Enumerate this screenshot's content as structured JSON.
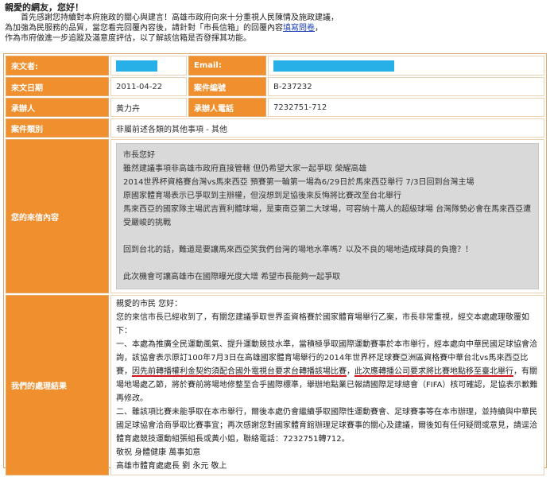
{
  "intro": {
    "greeting": "親愛的網友，您好！",
    "line1": "首先感謝您持續對本府施政的關心與建言！高雄市政府向來十分重視人民陳情及施政建議，",
    "line2_before": "為加強為民服務的品質，當您看完回覆內容後，請針對「市長信箱」的回覆內容",
    "line2_link": "填寫問卷",
    "line2_after": "，",
    "line3": "作為市府做進一步追蹤及滿意度評估，以了解該信箱是否發揮其功能。"
  },
  "fields": {
    "sender_label": "來文者:",
    "email_label": "Email:",
    "date_label": "來文日期",
    "date_value": "2011-04-22",
    "case_no_label": "案件編號",
    "case_no_value": "B-237232",
    "handler_label": "承辦人",
    "handler_value": "黃力卉",
    "handler_phone_label": "承辦人電話",
    "handler_phone_value": "7232751-712",
    "category_label": "案件類別",
    "category_value": "非屬前述各類的其他事項 - 其他",
    "letter_label": "您的來信內容",
    "result_label": "我們的處理結果"
  },
  "letter": {
    "l1": "市長您好",
    "l2": "雖然建議事項非高雄市政府直接管轄 但仍希望大家一起爭取 榮耀高雄",
    "l3": "2014世界杯資格賽台灣vs馬來西亞 預賽第一輪第一場為6/29日於馬來西亞舉行 7/3日回到台灣主場",
    "l4": "原國家體育場表示已爭取到主辦權，但沒想到足協後來反悔將比賽改至台北舉行",
    "l5": "馬來西亞的國家隊主場武吉賈利體球場，是東南亞第二大球場，可容納十萬人的超級球場 台灣隊勢必會在馬來西亞遭受嚴峻的挑戰",
    "l6": "回到台北的話，難道是要讓馬來西亞笑我們台灣的場地水準嗎？以及不良的場地造成球員的負擔？！",
    "l7": "此次機會可讓高雄市在國際曝光度大增 希望市長能夠一起爭取"
  },
  "reply": {
    "r1": "親愛的市民 您好：",
    "r2": "您的來信市長已經收到了，有關您建議爭取世界盃資格賽於國家體育場舉行乙案，市長非常重視，經交本處處理敬覆如下：",
    "r3a": "一、本處為推廣全民運動風氣、提升運動競技水準，當積極爭取國際運動賽事於本市舉行，經本處向中華民國足球協會洽詢，該協會表示原訂100年7月3日在高雄國家體育場舉行的2014年世界杯足球賽亞洲區資格賽中華台北vs馬來西亞比賽，",
    "r3b": "因先前轉播權利金契約須配合國外電視台要求台轉播該場比賽",
    "r3c": "，",
    "r3d": "此次應轉播公司要求將比賽地點移至臺北舉行",
    "r3e": "，有關場地場處乙節，將於賽前將場地修整至合乎國際標準，舉辦地點業已報請國際足球總會（FIFA）核可確認，足協表示歉難再修改。",
    "r4": "二、雖該項比賽未能爭取在本市舉行，爾後本處仍會繼續爭取國際性運動賽會、足球賽事等在本市辦理，並持續與中華民國足球協會洽商爭取比賽事宜；再次感謝您對國家體育館辦理足球賽事的關心及建議，爾後如有任何疑問或意見，請逕洽體育處競技運動組張組長或黃小姐，聯絡電話：7232751轉712。",
    "r5": "敬祝 身體健康 萬事如意",
    "r6": "高雄市體育處處長 劉 永元 敬上"
  },
  "colors": {
    "label_bg": "#ef8f2e",
    "frame_border": "#d7a56c",
    "redaction": "#27b0e8",
    "letter_bg": "#d9d9d9",
    "underline_red": "#d0141a"
  }
}
